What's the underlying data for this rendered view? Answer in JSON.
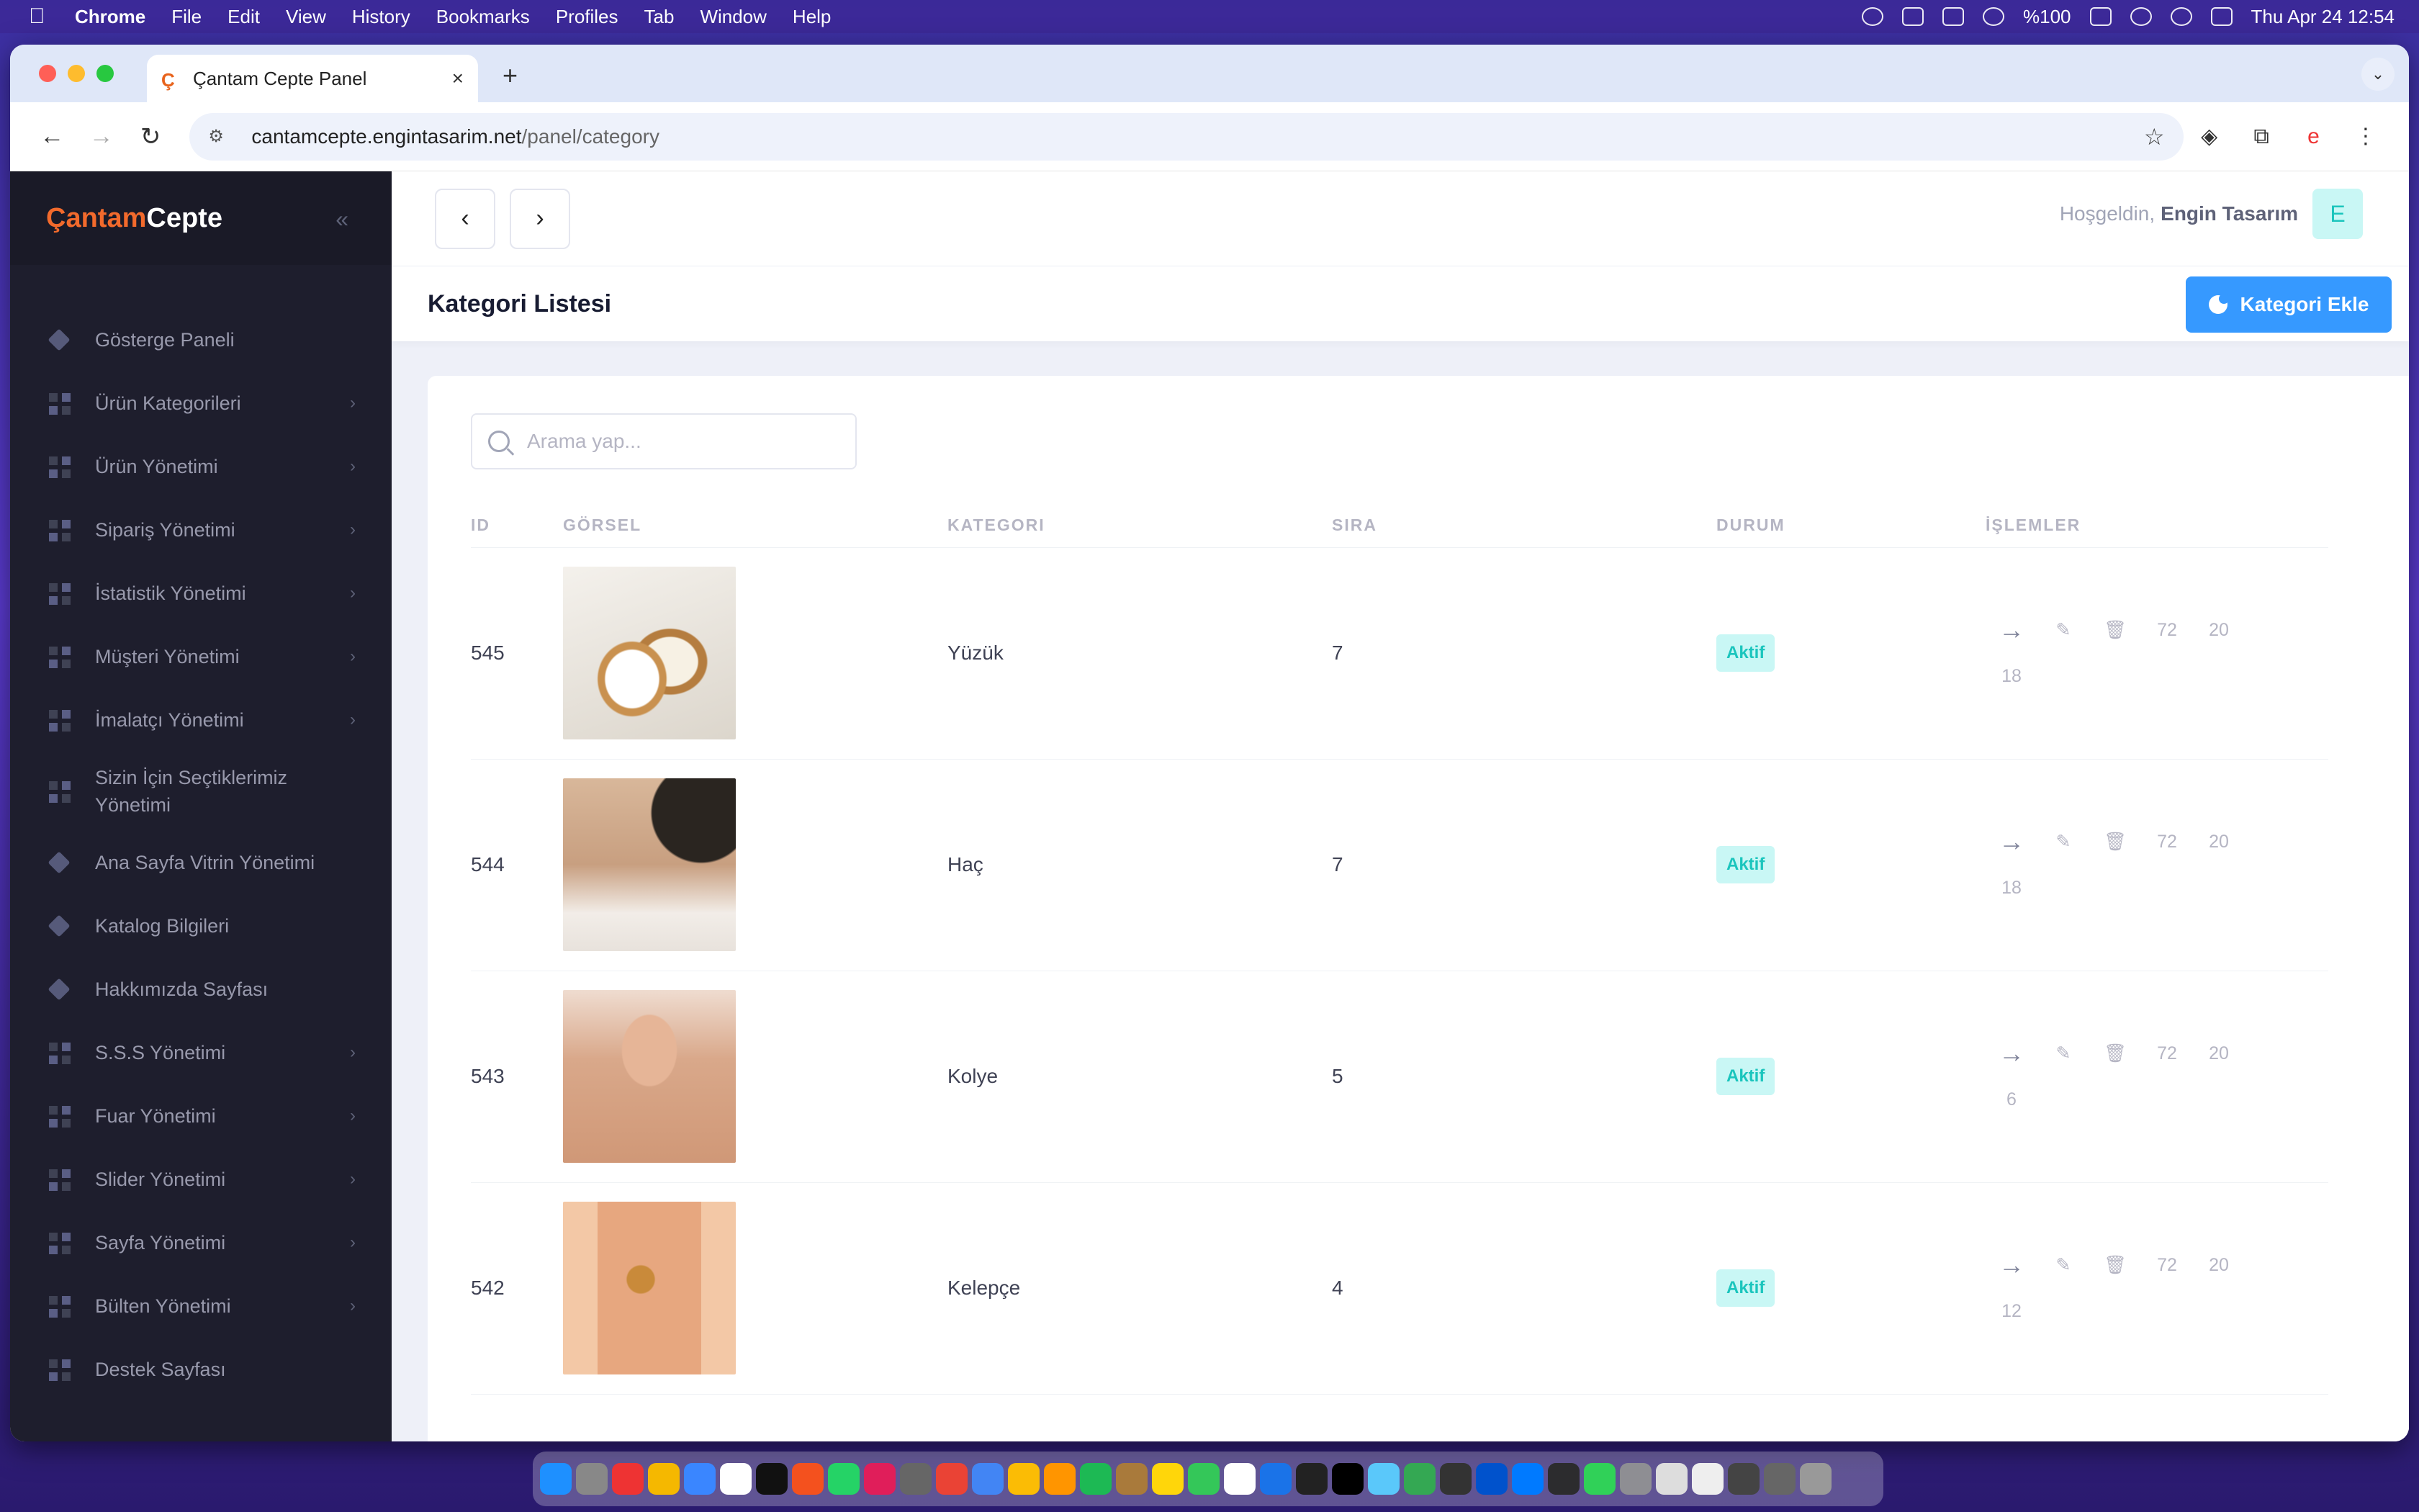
{
  "menubar": {
    "app": "Chrome",
    "items": [
      "File",
      "Edit",
      "View",
      "History",
      "Bookmarks",
      "Profiles",
      "Tab",
      "Window",
      "Help"
    ],
    "battery": "%100",
    "datetime": "Thu Apr 24  12:54"
  },
  "browser": {
    "tab_title": "Çantam Cepte Panel",
    "url_host": "cantamcepte.engintasarim.net",
    "url_path": "/panel/category"
  },
  "sidebar": {
    "logo_a": "Çantam",
    "logo_b": "Cepte",
    "items": [
      {
        "label": "Gösterge Paneli",
        "icon": "diamond-icon",
        "arrow": false
      },
      {
        "label": "Ürün Kategorileri",
        "icon": "grid-icon",
        "arrow": true
      },
      {
        "label": "Ürün Yönetimi",
        "icon": "grid-icon",
        "arrow": true
      },
      {
        "label": "Sipariş Yönetimi",
        "icon": "grid-icon",
        "arrow": true
      },
      {
        "label": "İstatistik Yönetimi",
        "icon": "grid-icon",
        "arrow": true
      },
      {
        "label": "Müşteri Yönetimi",
        "icon": "grid-icon",
        "arrow": true
      },
      {
        "label": "İmalatçı Yönetimi",
        "icon": "grid-icon",
        "arrow": true
      },
      {
        "label": "Sizin İçin Seçtiklerimiz Yönetimi",
        "icon": "grid-icon",
        "arrow": false
      },
      {
        "label": "Ana Sayfa Vitrin Yönetimi",
        "icon": "diamond-icon",
        "arrow": false
      },
      {
        "label": "Katalog Bilgileri",
        "icon": "diamond-icon",
        "arrow": false
      },
      {
        "label": "Hakkımızda Sayfası",
        "icon": "diamond-icon",
        "arrow": false
      },
      {
        "label": "S.S.S Yönetimi",
        "icon": "grid-icon",
        "arrow": true
      },
      {
        "label": "Fuar Yönetimi",
        "icon": "grid-icon",
        "arrow": true
      },
      {
        "label": "Slider Yönetimi",
        "icon": "grid-icon",
        "arrow": true
      },
      {
        "label": "Sayfa Yönetimi",
        "icon": "grid-icon",
        "arrow": true
      },
      {
        "label": "Bülten Yönetimi",
        "icon": "grid-icon",
        "arrow": true
      },
      {
        "label": "Destek Sayfası",
        "icon": "grid-icon",
        "arrow": false
      }
    ]
  },
  "header": {
    "welcome": "Hoşgeldin,",
    "user": "Engin Tasarım",
    "avatar_letter": "E"
  },
  "toolbar": {
    "title": "Kategori Listesi",
    "add_label": "Kategori Ekle"
  },
  "search": {
    "placeholder": "Arama yap..."
  },
  "table": {
    "columns": [
      "ID",
      "GÖRSEL",
      "KATEGORI",
      "SIRA",
      "DURUM",
      "İŞLEMLER"
    ],
    "rows": [
      {
        "id": "545",
        "name": "Yüzük",
        "order": "7",
        "status": "Aktif",
        "ops": [
          "72",
          "20",
          "18"
        ],
        "img": "ring"
      },
      {
        "id": "544",
        "name": "Haç",
        "order": "7",
        "status": "Aktif",
        "ops": [
          "72",
          "20",
          "18"
        ],
        "img": "cross"
      },
      {
        "id": "543",
        "name": "Kolye",
        "order": "5",
        "status": "Aktif",
        "ops": [
          "72",
          "20",
          "6"
        ],
        "img": "necklace"
      },
      {
        "id": "542",
        "name": "Kelepçe",
        "order": "4",
        "status": "Aktif",
        "ops": [
          "72",
          "20",
          "12"
        ],
        "img": "bracelet"
      }
    ]
  },
  "colors": {
    "accent": "#3699ff",
    "brand": "#f26a2c",
    "sidebar": "#1e1e2d",
    "success_bg": "#c9f7f5",
    "success": "#1bc5bd"
  }
}
